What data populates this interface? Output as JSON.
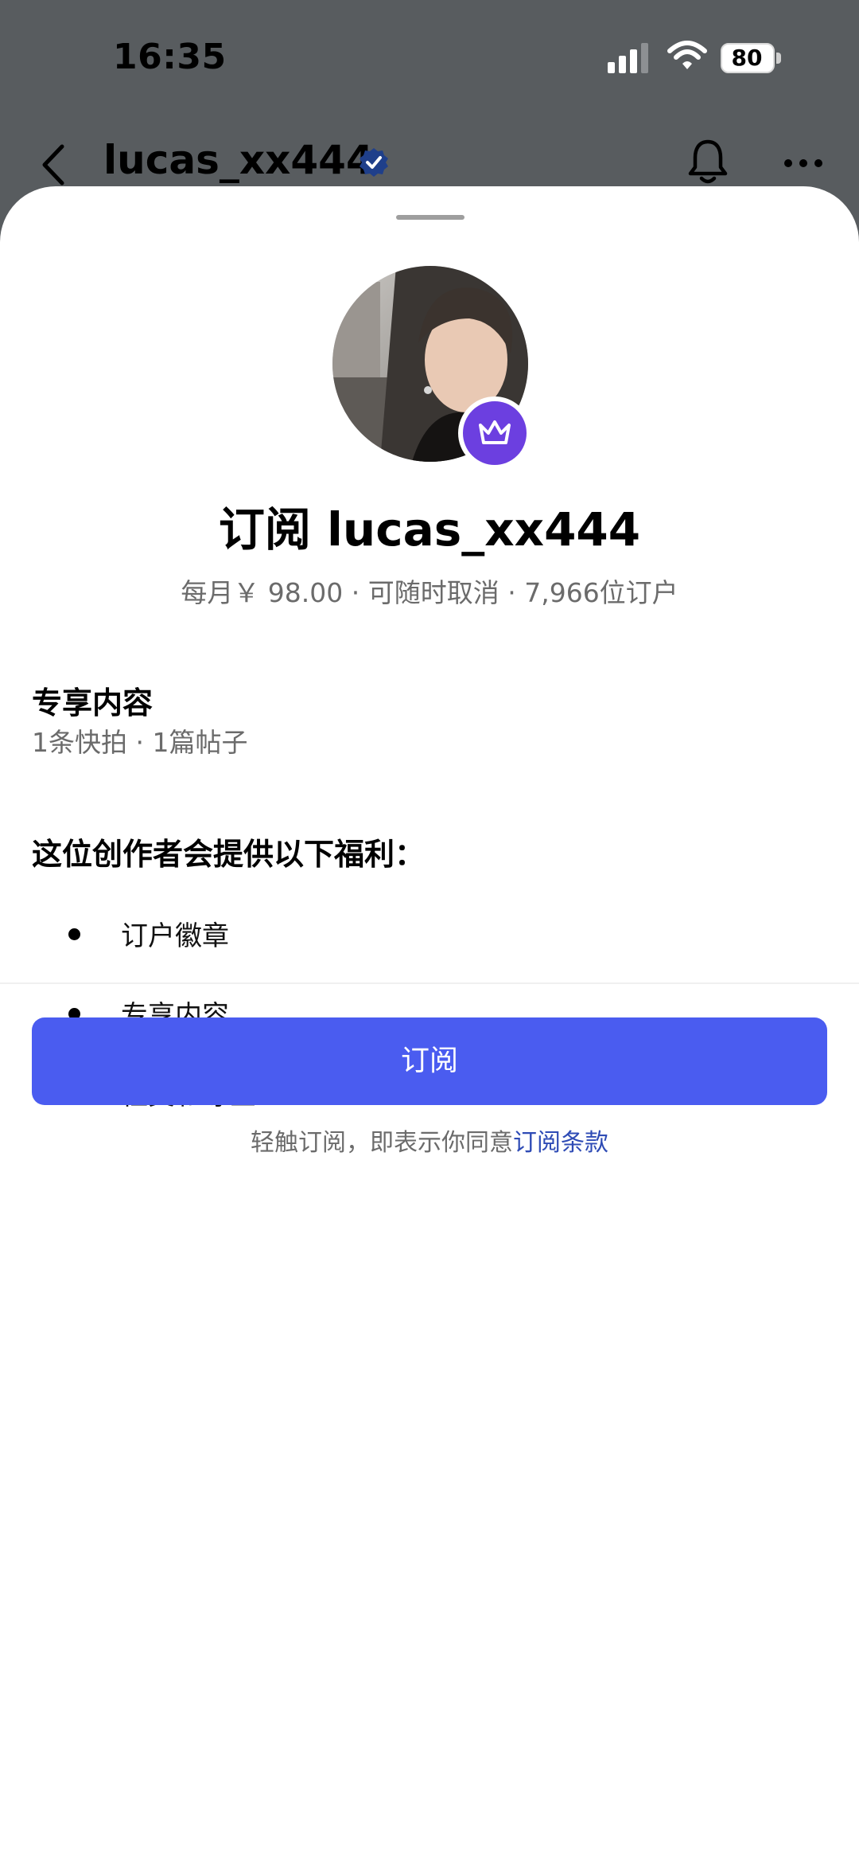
{
  "status_bar": {
    "time": "16:35",
    "battery": "80",
    "icons": [
      "signal-icon",
      "wifi-icon",
      "battery-icon"
    ]
  },
  "header": {
    "username": "lucas_xx444",
    "icons": [
      "back-icon",
      "verified-icon",
      "bell-icon",
      "more-icon"
    ]
  },
  "sheet": {
    "title": "订阅 lucas_xx444",
    "meta": "每月￥ 98.00 · 可随时取消 · 7,966位订户",
    "exclusive": {
      "title": "专享内容",
      "subtitle": "1条快拍 · 1篇帖子"
    },
    "benefits": {
      "title": "这位创作者会提供以下福利：",
      "items": [
        "订户徽章",
        "专享内容",
        "社交和專區"
      ]
    },
    "subscribe_button": "订阅",
    "terms_prefix": "轻触订阅，即表示你同意",
    "terms_link": "订阅条款"
  },
  "colors": {
    "backdrop": "#585c5f",
    "button": "#4a5cf0",
    "badge": "#6c3fe0",
    "link": "#2e4bb5"
  }
}
